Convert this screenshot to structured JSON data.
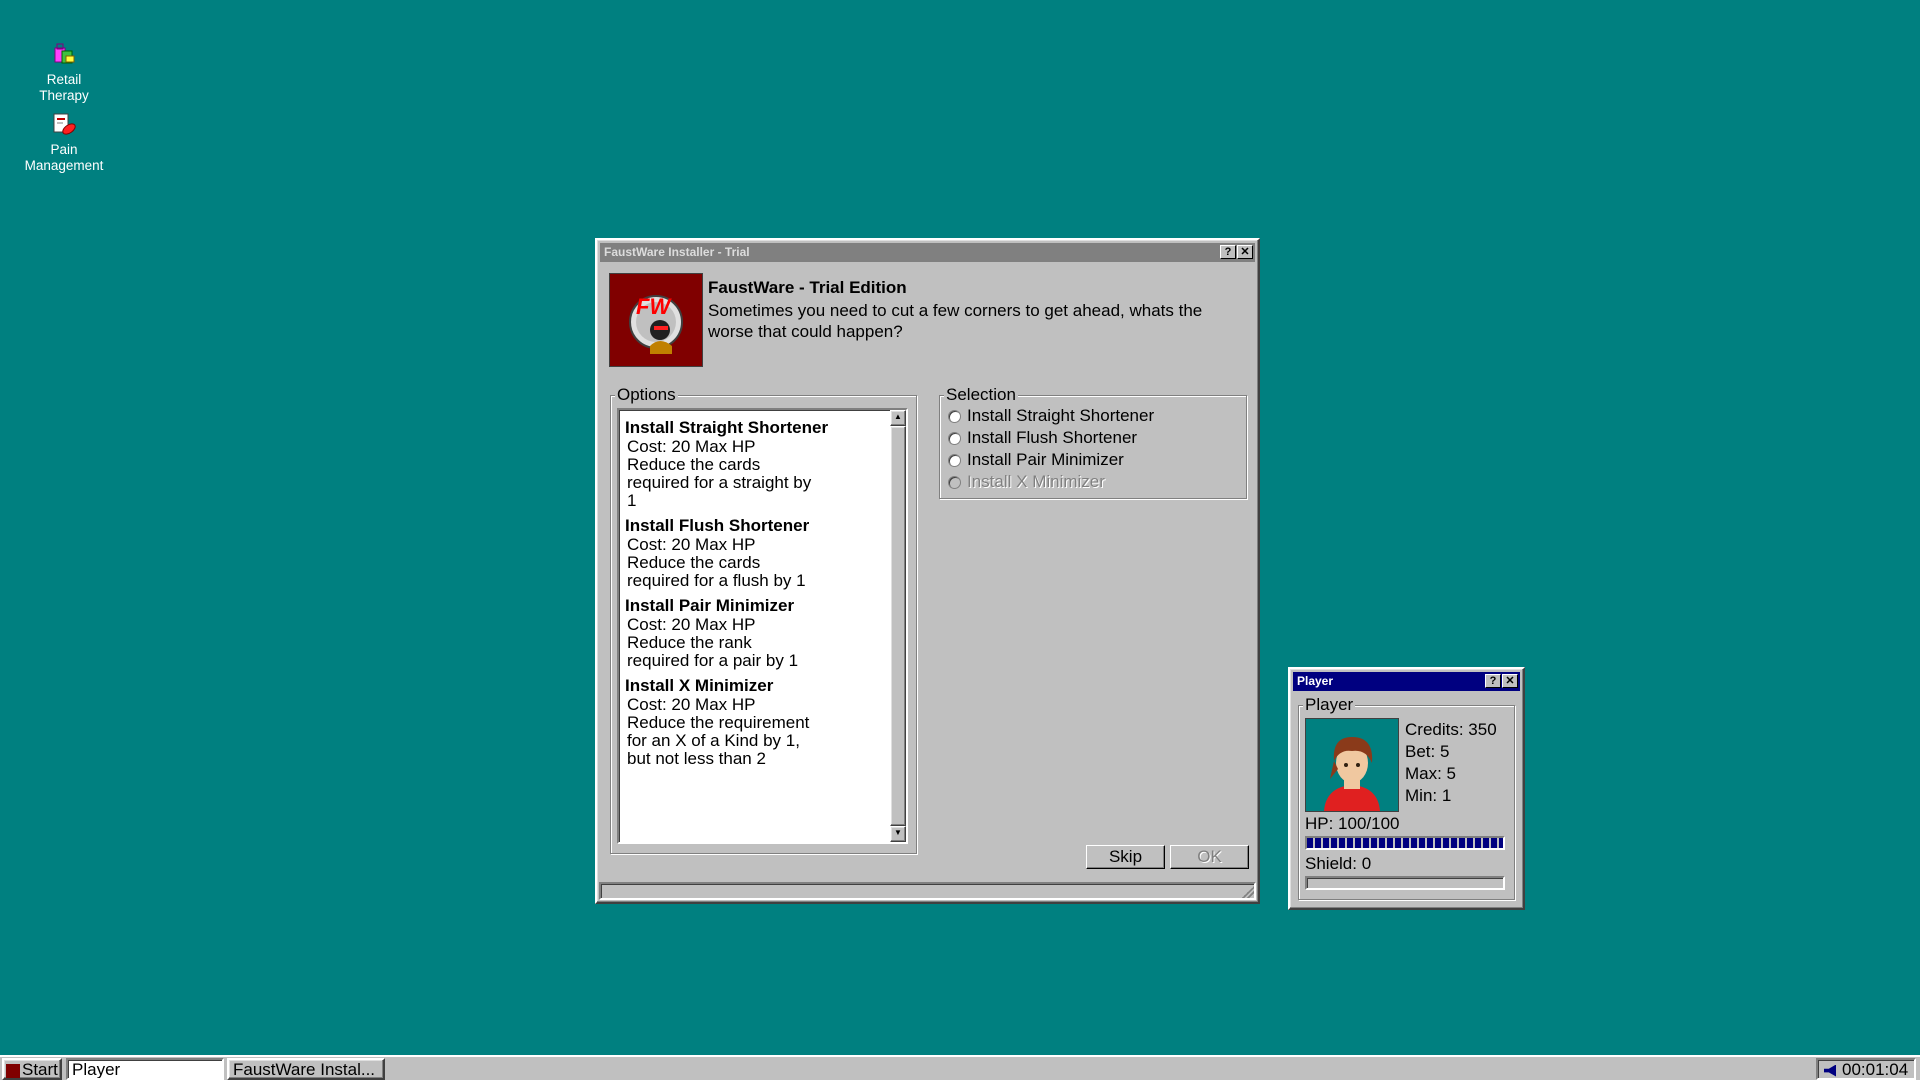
{
  "desktop": {
    "icons": [
      {
        "label_line1": "Retail",
        "label_line2": "Therapy",
        "icon": "shopping-bags-icon"
      },
      {
        "label_line1": "Pain",
        "label_line2": "Management",
        "icon": "pills-icon"
      }
    ]
  },
  "installer": {
    "title": "FaustWare Installer - Trial",
    "help_label": "?",
    "close_label": "✕",
    "logo_text": "FW",
    "product_name": "FaustWare - Trial Edition",
    "tagline": "Sometimes you need to cut a few corners to get ahead, whats the worse that could happen?",
    "options_label": "Options",
    "options": [
      {
        "title": "Install Straight Shortener",
        "lines": [
          "Cost: 20 Max HP",
          "Reduce the cards",
          "required for a straight by",
          "1"
        ]
      },
      {
        "title": "Install Flush Shortener",
        "lines": [
          "Cost: 20 Max HP",
          "Reduce the cards",
          "required for a flush by 1"
        ]
      },
      {
        "title": "Install Pair Minimizer",
        "lines": [
          "Cost: 20 Max HP",
          "Reduce the rank",
          "required for a pair by 1"
        ]
      },
      {
        "title": "Install X Minimizer",
        "lines": [
          "Cost: 20 Max HP",
          "Reduce the requirement",
          "for an X of a Kind by 1,",
          "but not less than 2"
        ]
      }
    ],
    "selection_label": "Selection",
    "selection": [
      {
        "label": "Install Straight Shortener",
        "enabled": true
      },
      {
        "label": "Install Flush Shortener",
        "enabled": true
      },
      {
        "label": "Install Pair Minimizer",
        "enabled": true
      },
      {
        "label": "Install X Minimizer",
        "enabled": false
      }
    ],
    "skip_label": "Skip",
    "ok_label": "OK"
  },
  "player": {
    "title": "Player",
    "help_label": "?",
    "close_label": "✕",
    "group_label": "Player",
    "credits": "Credits: 350",
    "bet": "Bet: 5",
    "max": "Max: 5",
    "min": "Min: 1",
    "hp": "HP: 100/100",
    "hp_fraction": 1.0,
    "shield": "Shield: 0",
    "shield_fraction": 0.0
  },
  "taskbar": {
    "start_label": "Start",
    "tasks": [
      "Player",
      "FaustWare Instal..."
    ],
    "clock": "00:01:04"
  },
  "colors": {
    "desktop": "#008080",
    "title_active": "#000080",
    "title_inactive": "#808080",
    "hp_bar": "#000080"
  }
}
